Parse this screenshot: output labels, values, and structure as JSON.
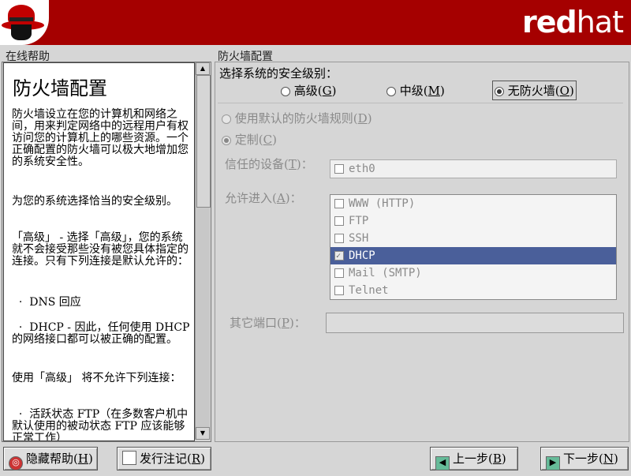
{
  "header": {
    "brand_bold": "red",
    "brand_light": "hat"
  },
  "help": {
    "section_label": "在线帮助",
    "title": "防火墙配置",
    "paragraphs": [
      "防火墙设立在您的计算机和网络之间，用来判定网络中的远程用户有权访问您的计算机上的哪些资源。一个正确配置的防火墙可以极大地增加您的系统安全性。",
      "为您的系统选择恰当的安全级别。",
      "「高级」 - 选择「高级」，您的系统就不会接受那些没有被您具体指定的连接。只有下列连接是默认允许的：",
      "  ·  DNS 回应",
      "  ·  DHCP - 因此，任何使用 DHCP 的网络接口都可以被正确的配置。",
      "使用「高级」 将不允许下列连接：",
      "  ·  活跃状态 FTP（在多数客户机中默认使用的被动状态 FTP 应该能够正常工作）"
    ]
  },
  "firewall": {
    "section_label": "防火墙配置",
    "level_prompt": "选择系统的安全级别：",
    "levels": [
      {
        "label": "高级",
        "key": "G"
      },
      {
        "label": "中级",
        "key": "M"
      },
      {
        "label": "无防火墙",
        "key": "O"
      }
    ],
    "selected_level": "无防火墙",
    "use_default": {
      "label": "使用默认的防火墙规则",
      "key": "D"
    },
    "customize": {
      "label": "定制",
      "key": "C"
    },
    "trusted_label": "信任的设备",
    "trusted_key": "T",
    "trusted_devices": [
      {
        "name": "eth0",
        "checked": false
      }
    ],
    "allow_label": "允许进入",
    "allow_key": "A",
    "allow_items": [
      {
        "name": "WWW (HTTP)",
        "checked": false,
        "selected": false
      },
      {
        "name": "FTP",
        "checked": false,
        "selected": false
      },
      {
        "name": "SSH",
        "checked": false,
        "selected": false
      },
      {
        "name": "DHCP",
        "checked": true,
        "selected": true
      },
      {
        "name": "Mail (SMTP)",
        "checked": false,
        "selected": false
      },
      {
        "name": "Telnet",
        "checked": false,
        "selected": false
      }
    ],
    "other_ports_label": "其它端口",
    "other_ports_key": "P",
    "other_ports_value": ""
  },
  "buttons": {
    "hide_help": {
      "label": "隐藏帮助",
      "key": "H"
    },
    "release_notes": {
      "label": "发行注记",
      "key": "R"
    },
    "back": {
      "label": "上一步",
      "key": "B"
    },
    "next": {
      "label": "下一步",
      "key": "N"
    }
  },
  "colors": {
    "header_red": "#a50000",
    "selection_blue": "#4a5f9a"
  }
}
